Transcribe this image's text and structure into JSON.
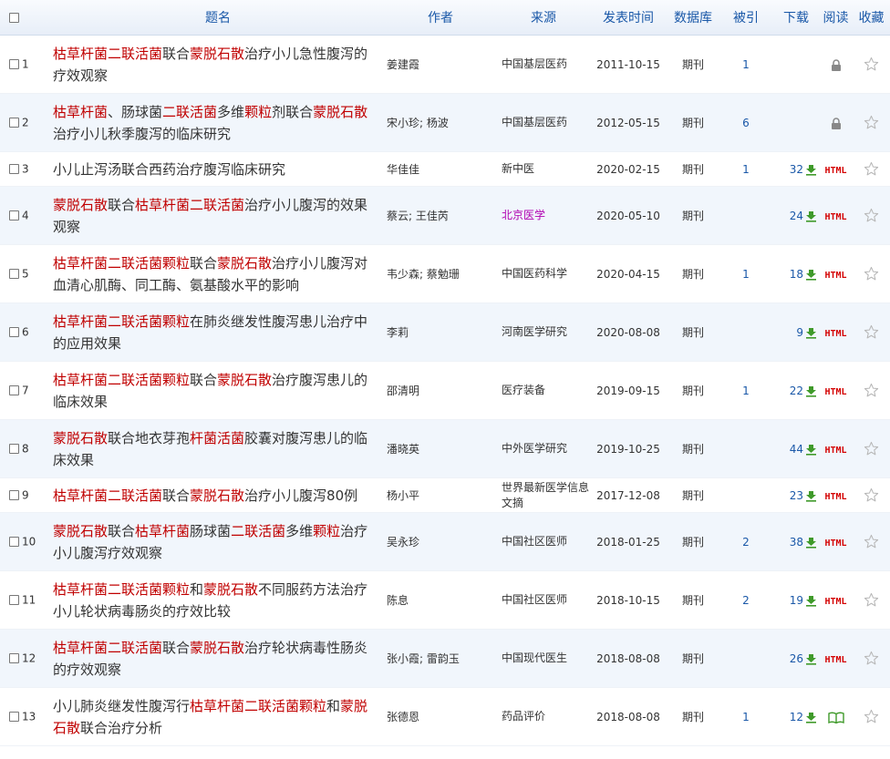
{
  "headers": {
    "title": "题名",
    "author": "作者",
    "source": "来源",
    "date": "发表时间",
    "db": "数据库",
    "cite": "被引",
    "download": "下载",
    "read": "阅读",
    "fav": "收藏"
  },
  "colors": {
    "highlight": "#c00000",
    "link": "#1a58a8",
    "html": "#d40000",
    "purple_source": "#b000b0"
  },
  "rows": [
    {
      "num": "1",
      "title_parts": [
        {
          "t": "枯草杆菌二联活菌",
          "h": true
        },
        {
          "t": "联合"
        },
        {
          "t": "蒙脱石散",
          "h": true
        },
        {
          "t": "治疗小儿急性腹泻的疗效观察"
        }
      ],
      "author": "姜建霞",
      "source": "中国基层医药",
      "date": "2011-10-15",
      "db": "期刊",
      "cite": "1",
      "download": "",
      "read": "lock",
      "fav": "star"
    },
    {
      "num": "2",
      "title_parts": [
        {
          "t": "枯草杆菌",
          "h": true
        },
        {
          "t": "、肠球菌"
        },
        {
          "t": "二联活菌",
          "h": true
        },
        {
          "t": "多维"
        },
        {
          "t": "颗粒",
          "h": true
        },
        {
          "t": "剂联合"
        },
        {
          "t": "蒙脱石散",
          "h": true
        },
        {
          "t": "治疗小儿秋季腹泻的临床研究"
        }
      ],
      "author": "宋小珍; 杨波",
      "source": "中国基层医药",
      "date": "2012-05-15",
      "db": "期刊",
      "cite": "6",
      "download": "",
      "read": "lock",
      "fav": "star"
    },
    {
      "num": "3",
      "title_parts": [
        {
          "t": "小儿止泻汤联合西药治疗腹泻临床研究"
        }
      ],
      "author": "华佳佳",
      "source": "新中医",
      "date": "2020-02-15",
      "db": "期刊",
      "cite": "1",
      "download": "32",
      "read": "HTML",
      "fav": "star"
    },
    {
      "num": "4",
      "title_parts": [
        {
          "t": "蒙脱石散",
          "h": true
        },
        {
          "t": "联合"
        },
        {
          "t": "枯草杆菌二联活菌",
          "h": true
        },
        {
          "t": "治疗小儿腹泻的效果观察"
        }
      ],
      "author": "蔡云; 王佳芮",
      "source": "北京医学",
      "date": "2020-05-10",
      "db": "期刊",
      "cite": "",
      "download": "24",
      "read": "HTML",
      "fav": "star"
    },
    {
      "num": "5",
      "title_parts": [
        {
          "t": "枯草杆菌二联活菌颗粒",
          "h": true
        },
        {
          "t": "联合"
        },
        {
          "t": "蒙脱石散",
          "h": true
        },
        {
          "t": "治疗小儿腹泻对血清心肌酶、同工酶、氨基酸水平的影响"
        }
      ],
      "author": "韦少森; 蔡勉珊",
      "source": "中国医药科学",
      "date": "2020-04-15",
      "db": "期刊",
      "cite": "1",
      "download": "18",
      "read": "HTML",
      "fav": "star"
    },
    {
      "num": "6",
      "title_parts": [
        {
          "t": "枯草杆菌二联活菌颗粒",
          "h": true
        },
        {
          "t": "在肺炎继发性腹泻患儿治疗中的应用效果"
        }
      ],
      "author": "李莉",
      "source": "河南医学研究",
      "date": "2020-08-08",
      "db": "期刊",
      "cite": "",
      "download": "9",
      "read": "HTML",
      "fav": "star"
    },
    {
      "num": "7",
      "title_parts": [
        {
          "t": "枯草杆菌二联活菌颗粒",
          "h": true
        },
        {
          "t": "联合"
        },
        {
          "t": "蒙脱石散",
          "h": true
        },
        {
          "t": "治疗腹泻患儿的临床效果"
        }
      ],
      "author": "邵清明",
      "source": "医疗装备",
      "date": "2019-09-15",
      "db": "期刊",
      "cite": "1",
      "download": "22",
      "read": "HTML",
      "fav": "star"
    },
    {
      "num": "8",
      "title_parts": [
        {
          "t": "蒙脱石散",
          "h": true
        },
        {
          "t": "联合地衣芽孢"
        },
        {
          "t": "杆菌活菌",
          "h": true
        },
        {
          "t": "胶囊对腹泻患儿的临床效果"
        }
      ],
      "author": "潘晓英",
      "source": "中外医学研究",
      "date": "2019-10-25",
      "db": "期刊",
      "cite": "",
      "download": "44",
      "read": "HTML",
      "fav": "star"
    },
    {
      "num": "9",
      "title_parts": [
        {
          "t": "枯草杆菌二联活菌",
          "h": true
        },
        {
          "t": "联合"
        },
        {
          "t": "蒙脱石散",
          "h": true
        },
        {
          "t": "治疗小儿腹泻80例"
        }
      ],
      "author": "杨小平",
      "source": "世界最新医学信息文摘",
      "date": "2017-12-08",
      "db": "期刊",
      "cite": "",
      "download": "23",
      "read": "HTML",
      "fav": "star"
    },
    {
      "num": "10",
      "title_parts": [
        {
          "t": "蒙脱石散",
          "h": true
        },
        {
          "t": "联合"
        },
        {
          "t": "枯草杆菌",
          "h": true
        },
        {
          "t": "肠球菌"
        },
        {
          "t": "二联活菌",
          "h": true
        },
        {
          "t": "多维"
        },
        {
          "t": "颗粒",
          "h": true
        },
        {
          "t": "治疗小儿腹泻疗效观察"
        }
      ],
      "author": "吴永珍",
      "source": "中国社区医师",
      "date": "2018-01-25",
      "db": "期刊",
      "cite": "2",
      "download": "38",
      "read": "HTML",
      "fav": "star"
    },
    {
      "num": "11",
      "title_parts": [
        {
          "t": "枯草杆菌二联活菌颗粒",
          "h": true
        },
        {
          "t": "和"
        },
        {
          "t": "蒙脱石散",
          "h": true
        },
        {
          "t": "不同服药方法治疗小儿轮状病毒肠炎的疗效比较"
        }
      ],
      "author": "陈息",
      "source": "中国社区医师",
      "date": "2018-10-15",
      "db": "期刊",
      "cite": "2",
      "download": "19",
      "read": "HTML",
      "fav": "star"
    },
    {
      "num": "12",
      "title_parts": [
        {
          "t": "枯草杆菌二联活菌",
          "h": true
        },
        {
          "t": "联合"
        },
        {
          "t": "蒙脱石散",
          "h": true
        },
        {
          "t": "治疗轮状病毒性肠炎的疗效观察"
        }
      ],
      "author": "张小霞; 雷韵玉",
      "source": "中国现代医生",
      "date": "2018-08-08",
      "db": "期刊",
      "cite": "",
      "download": "26",
      "read": "HTML",
      "fav": "star"
    },
    {
      "num": "13",
      "title_parts": [
        {
          "t": "小儿肺炎继发性腹泻行"
        },
        {
          "t": "枯草杆菌二联活菌颗粒",
          "h": true
        },
        {
          "t": "和"
        },
        {
          "t": "蒙脱石散",
          "h": true
        },
        {
          "t": "联合治疗分析"
        }
      ],
      "author": "张德恩",
      "source": "药品评价",
      "date": "2018-08-08",
      "db": "期刊",
      "cite": "1",
      "download": "12",
      "read": "book",
      "fav": "star"
    }
  ]
}
